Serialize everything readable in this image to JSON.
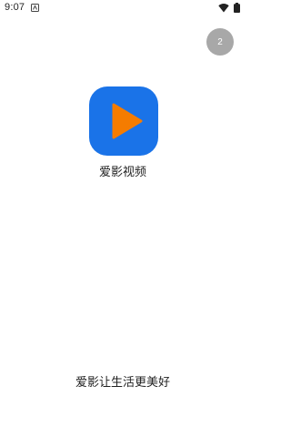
{
  "status_bar": {
    "time": "9:07",
    "icons": [
      "notification-icon",
      "wifi-icon",
      "battery-icon"
    ]
  },
  "splash": {
    "skip_countdown": "2",
    "app_name": "爱影视频",
    "slogan": "爱影让生活更美好",
    "logo_icon": "play-icon",
    "colors": {
      "logo_background": "#1a73e8",
      "play_triangle": "#f57c00",
      "skip_button": "#a8a8a8"
    }
  }
}
